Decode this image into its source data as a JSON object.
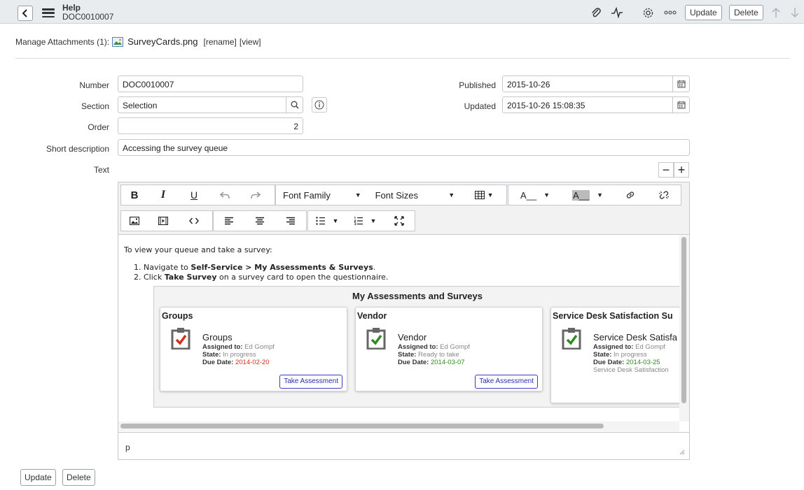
{
  "header": {
    "title": "Help",
    "subtitle": "DOC0010007",
    "update_label": "Update",
    "delete_label": "Delete"
  },
  "attachments": {
    "label": "Manage Attachments (1):",
    "file_name": "SurveyCards.png",
    "rename_label": "[rename]",
    "view_label": "[view]"
  },
  "form": {
    "number_label": "Number",
    "number_value": "DOC0010007",
    "section_label": "Section",
    "section_value": "Selection",
    "order_label": "Order",
    "order_value": "2",
    "short_description_label": "Short description",
    "short_description_value": "Accessing the survey queue",
    "text_label": "Text",
    "published_label": "Published",
    "published_value": "2015-10-26",
    "updated_label": "Updated",
    "updated_value": "2015-10-26 15:08:35"
  },
  "editor": {
    "toolbar": {
      "bold": "B",
      "italic": "I",
      "underline": "U",
      "font_family": "Font Family",
      "font_sizes": "Font Sizes",
      "text_color": "A__",
      "bg_color": "A__"
    },
    "intro": "To view your queue and take a survey:",
    "steps": [
      {
        "prefix": "Navigate to ",
        "bold": "Self-Service > My Assessments & Surveys",
        "suffix": "."
      },
      {
        "prefix": "Click ",
        "bold": "Take Survey",
        "suffix": " on a survey card to open the questionnaire."
      }
    ],
    "status_path": "p"
  },
  "survey_image": {
    "title": "My Assessments and Surveys",
    "cards": [
      {
        "header": "Groups",
        "name": "Groups",
        "assigned_label": "Assigned to:",
        "assigned": "Ed Gompf",
        "state_label": "State:",
        "state": "In progress",
        "due_label": "Due Date:",
        "due": "2014-02-20",
        "due_color": "#d0311f",
        "extra": "",
        "button": "Take Assessment"
      },
      {
        "header": "Vendor",
        "name": "Vendor",
        "assigned_label": "Assigned to:",
        "assigned": "Ed Gompf",
        "state_label": "State:",
        "state": "Ready to take",
        "due_label": "Due Date:",
        "due": "2014-03-07",
        "due_color": "#2e8b22",
        "extra": "",
        "button": "Take Assessment"
      },
      {
        "header": "Service Desk Satisfaction Su",
        "name": "Service Desk Satisfa",
        "assigned_label": "Assigned to:",
        "assigned": "Ed Gompf",
        "state_label": "State:",
        "state": "In progress",
        "due_label": "Due Date:",
        "due": "2014-03-25",
        "due_color": "#2e8b22",
        "extra": "Service Desk Satisfaction",
        "button": ""
      }
    ]
  },
  "footer": {
    "update_label": "Update",
    "delete_label": "Delete"
  },
  "icons": [
    "back-icon",
    "menu-icon",
    "paperclip-icon",
    "activity-icon",
    "gear-icon",
    "more-icon",
    "arrow-up-icon",
    "arrow-down-icon",
    "image-icon",
    "search-icon",
    "info-icon",
    "calendar-icon"
  ]
}
